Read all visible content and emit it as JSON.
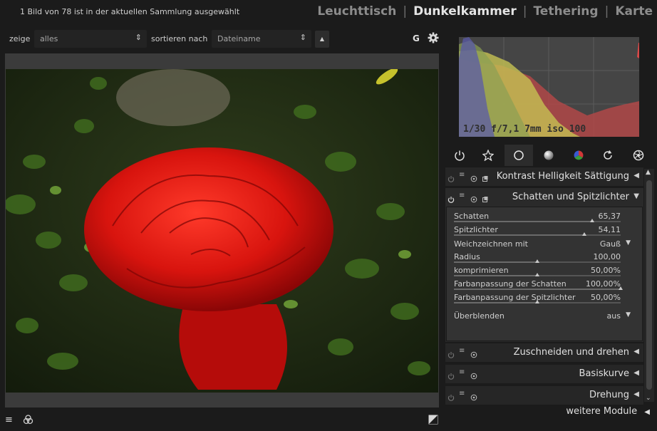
{
  "status": "1 Bild von 78 ist in der aktuellen Sammlung ausgewählt",
  "views": [
    {
      "label": "Leuchttisch",
      "active": false
    },
    {
      "label": "Dunkelkammer",
      "active": true
    },
    {
      "label": "Tethering",
      "active": false
    },
    {
      "label": "Karte",
      "active": false
    }
  ],
  "filter": {
    "show_label": "zeige",
    "show_value": "alles",
    "sort_label": "sortieren nach",
    "sort_value": "Dateiname",
    "sort_dir_icon": "triangle-up-icon",
    "grouping_label": "G",
    "prefs_icon": "gear-icon"
  },
  "histogram": {
    "exif": "1/30 f/7,1 7mm iso 100",
    "colors": {
      "red": "#b04848",
      "green": "#8aa052",
      "blue": "#5a5aa8",
      "yellow": "#c6c252"
    }
  },
  "module_groups": [
    "power-icon",
    "star-icon",
    "circle-icon",
    "shaded-circle-icon",
    "color-wheel-icon",
    "rotate-icon",
    "aperture-icon"
  ],
  "modules": {
    "contrast": {
      "title": "Kontrast Helligkeit Sättigung",
      "expanded": false
    },
    "shadows": {
      "title": "Schatten und Spitzlichter",
      "expanded": true
    },
    "crop": {
      "title": "Zuschneiden und drehen",
      "expanded": false
    },
    "basecurve": {
      "title": "Basiskurve",
      "expanded": false
    },
    "rotation": {
      "title": "Drehung",
      "expanded": false
    }
  },
  "shadows_params": {
    "shadows": {
      "label": "Schatten",
      "value": "65,37",
      "fraction": 0.83
    },
    "highlights": {
      "label": "Spitzlichter",
      "value": "54,11",
      "fraction": 0.78
    },
    "blur": {
      "label": "Weichzeichnen mit",
      "value": "Gauß"
    },
    "radius": {
      "label": "Radius",
      "value": "100,00",
      "fraction": 0.5
    },
    "compress": {
      "label": "komprimieren",
      "value": "50,00%",
      "fraction": 0.5
    },
    "shadow_sat": {
      "label": "Farbanpassung der Schatten",
      "value": "100,00%",
      "fraction": 1.0
    },
    "highlight_sat": {
      "label": "Farbanpassung der Spitzlichter",
      "value": "50,00%",
      "fraction": 0.5
    },
    "blend": {
      "label": "Überblenden",
      "value": "aus"
    }
  },
  "more_modules": "weitere Module"
}
